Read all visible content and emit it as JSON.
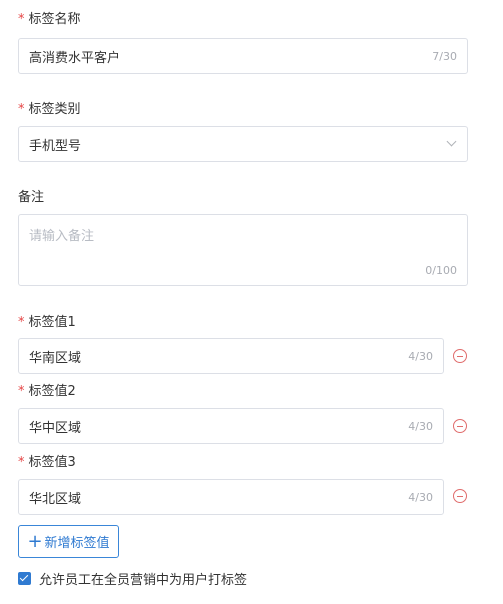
{
  "tag_name": {
    "label": "标签名称",
    "value": "高消费水平客户",
    "count": "7/30"
  },
  "tag_category": {
    "label": "标签类别",
    "value": "手机型号"
  },
  "remark": {
    "label": "备注",
    "placeholder": "请输入备注",
    "count": "0/100"
  },
  "tag_values": [
    {
      "label": "标签值1",
      "value": "华南区域",
      "count": "4/30"
    },
    {
      "label": "标签值2",
      "value": "华中区域",
      "count": "4/30"
    },
    {
      "label": "标签值3",
      "value": "华北区域",
      "count": "4/30"
    }
  ],
  "required_mark": "*",
  "add_button": {
    "icon": "+",
    "label": "新增标签值"
  },
  "allow_checkbox": {
    "checked": true,
    "label": "允许员工在全员营销中为用户打标签"
  },
  "colors": {
    "accent": "#2f7ad1",
    "required": "#e54545",
    "remove": "#e06c6c",
    "border": "#dcdfe6"
  }
}
